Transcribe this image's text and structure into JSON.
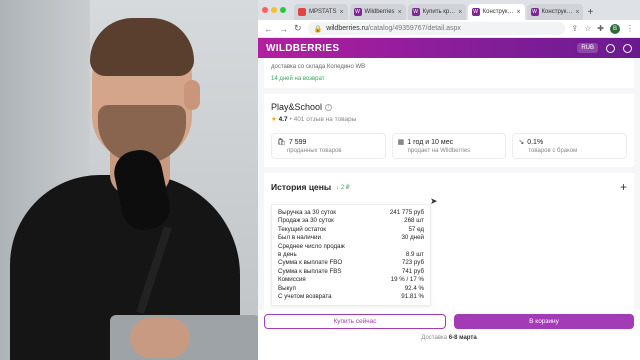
{
  "browser": {
    "tabs": [
      {
        "label": "MPSTATS",
        "active": false
      },
      {
        "label": "Wildberries",
        "active": false
      },
      {
        "label": "Купить кр…",
        "active": false
      },
      {
        "label": "Конструк…",
        "active": true
      },
      {
        "label": "Конструк…",
        "active": false
      }
    ],
    "url_host": "wildberries.ru",
    "url_path": "/catalog/49359767/detail.aspx",
    "profile_initial": "В"
  },
  "header": {
    "logo": "WILDBERRIES",
    "currency": "RUB",
    "accent": "#a33bb7"
  },
  "delivery_top": {
    "text": "доставка со склада Коледино WB",
    "returns": "14 дней на возврат"
  },
  "seller": {
    "name": "Play&School",
    "rating": "4.7",
    "reviews": "• 401 отзыв на товары",
    "stats": [
      {
        "value": "7 599",
        "label": "проданных товаров",
        "icon": "bag-icon"
      },
      {
        "value": "1 год и 10 мес",
        "label": "продает на Wildberries",
        "icon": "calendar-icon"
      },
      {
        "value": "0.1%",
        "label": "товаров с браком",
        "icon": "defect-icon"
      }
    ]
  },
  "history": {
    "title": "История цены",
    "badge": "↓ 2 ₽",
    "rows": [
      {
        "k": "Выручка за 30 суток",
        "v": "241 775 руб"
      },
      {
        "k": "Продаж за 30 суток",
        "v": "268 шт"
      },
      {
        "k": "Текущий остаток",
        "v": "57 ед"
      },
      {
        "k": "Был в наличии",
        "v": "30 дней"
      },
      {
        "k": "Среднее число продаж",
        "v": ""
      },
      {
        "k": "в день",
        "v": "8.9 шт"
      },
      {
        "k": "Сумма к выплате FBO",
        "v": "723 руб"
      },
      {
        "k": "Сумма к выплате FBS",
        "v": "741 руб"
      },
      {
        "k": "Комиссия",
        "v": "19 % / 17 %"
      },
      {
        "k": "Выкуп",
        "v": "92.4 %"
      },
      {
        "k": "С учетом возврата",
        "v": "91.81 %"
      }
    ]
  },
  "buy": {
    "buy_now": "Купить сейчас",
    "to_cart": "В корзину",
    "delivery_label": "Доставка",
    "delivery_date": "6-8 марта"
  }
}
